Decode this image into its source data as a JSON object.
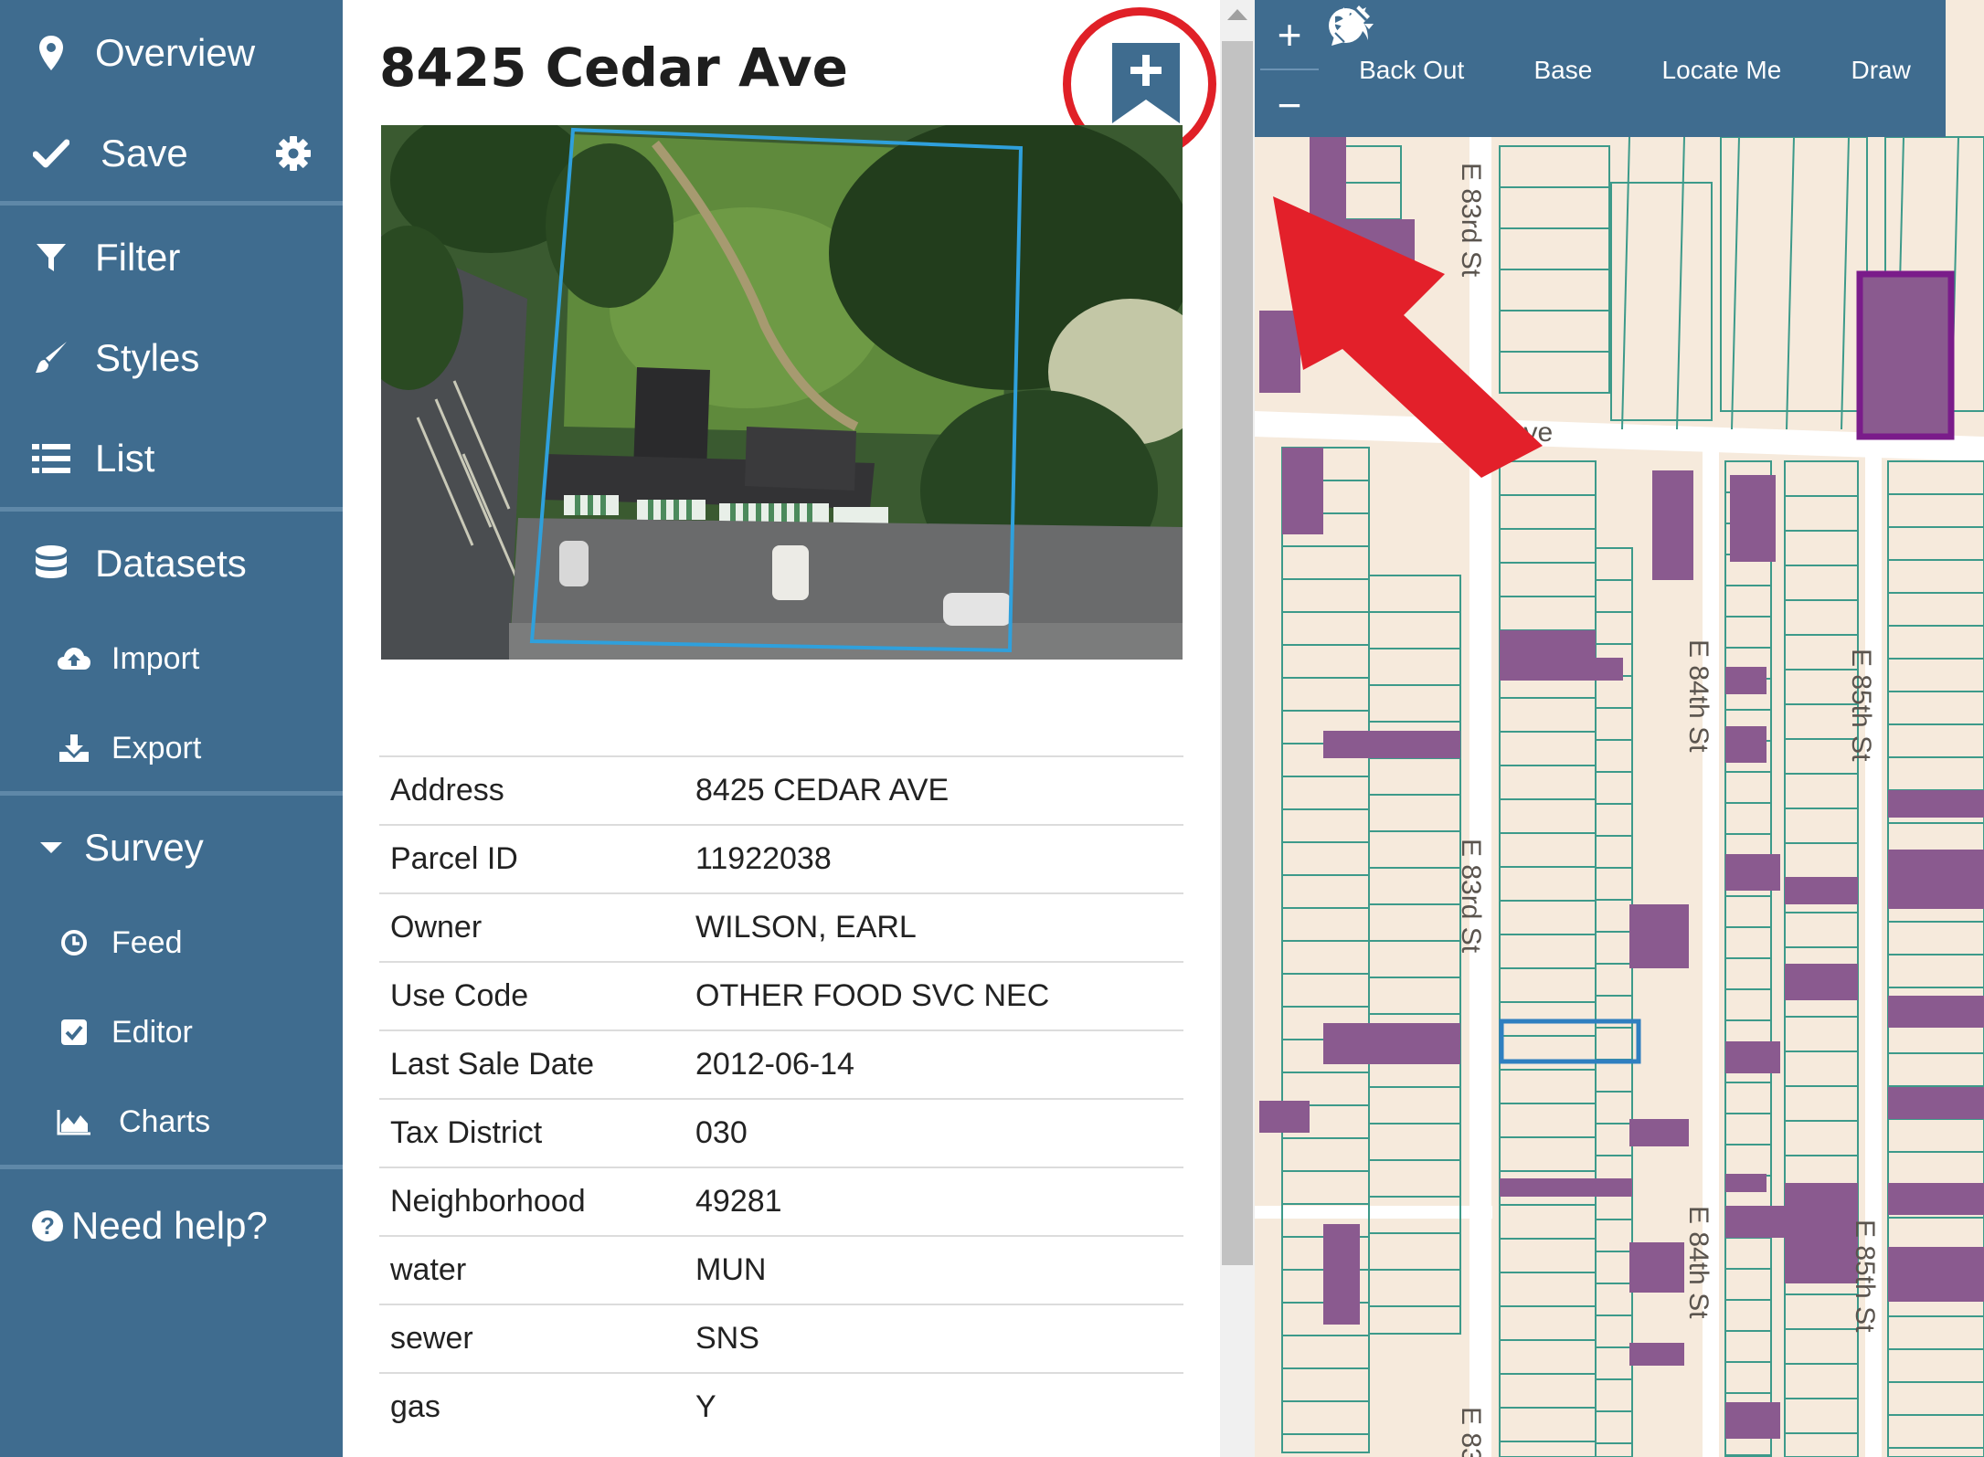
{
  "sidebar": {
    "overview": "Overview",
    "save": "Save",
    "filter": "Filter",
    "styles": "Styles",
    "list": "List",
    "datasets": "Datasets",
    "import": "Import",
    "export": "Export",
    "survey": "Survey",
    "feed": "Feed",
    "editor": "Editor",
    "charts": "Charts",
    "help": "Need help?"
  },
  "parcel": {
    "title": "8425 Cedar Ave",
    "attributes": [
      {
        "key": "Address",
        "value": "8425 CEDAR AVE"
      },
      {
        "key": "Parcel ID",
        "value": "11922038"
      },
      {
        "key": "Owner",
        "value": "WILSON, EARL"
      },
      {
        "key": "Use Code",
        "value": "OTHER FOOD SVC NEC"
      },
      {
        "key": "Last Sale Date",
        "value": "2012-06-14"
      },
      {
        "key": "Tax District",
        "value": "030"
      },
      {
        "key": "Neighborhood",
        "value": "49281"
      },
      {
        "key": "water",
        "value": "MUN"
      },
      {
        "key": "sewer",
        "value": "SNS"
      },
      {
        "key": "gas",
        "value": "Y"
      }
    ]
  },
  "map": {
    "toolbar": {
      "back_out": "Back Out",
      "base": "Base",
      "locate_me": "Locate Me",
      "draw": "Draw"
    },
    "zoom_in": "+",
    "zoom_out": "−",
    "streets": {
      "e83_top": "E 83rd St",
      "e83_mid": "E 83rd St",
      "e83_bottom": "E 83",
      "ave": "Ave",
      "e84_top": "E 84th St",
      "e84_bottom": "E 84th St",
      "e85_top": "E 85th St",
      "e85_bottom": "E 85th St"
    }
  },
  "colors": {
    "sidebar": "#3f6c8f",
    "accent_red": "#e02027",
    "parcel_fill": "#8a5a8f",
    "parcel_line": "#3d9a8a",
    "map_bg": "#f6eadc",
    "selected_outline": "#2f7fc0"
  }
}
